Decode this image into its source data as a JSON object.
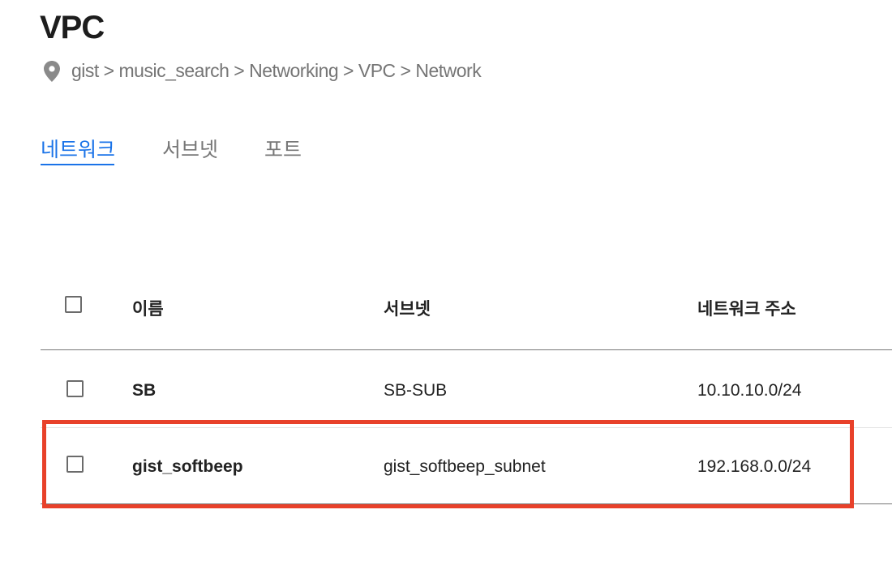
{
  "header": {
    "title": "VPC",
    "breadcrumb": "gist > music_search > Networking > VPC > Network"
  },
  "tabs": [
    {
      "label": "네트워크",
      "active": true
    },
    {
      "label": "서브넷",
      "active": false
    },
    {
      "label": "포트",
      "active": false
    }
  ],
  "table": {
    "columns": [
      "이름",
      "서브넷",
      "네트워크 주소"
    ],
    "rows": [
      {
        "name": "SB",
        "subnet": "SB-SUB",
        "address": "10.10.10.0/24"
      },
      {
        "name": "gist_softbeep",
        "subnet": "gist_softbeep_subnet",
        "address": "192.168.0.0/24",
        "highlighted": true
      }
    ]
  },
  "colors": {
    "accent": "#1a73e8",
    "highlight": "#e8412a"
  }
}
